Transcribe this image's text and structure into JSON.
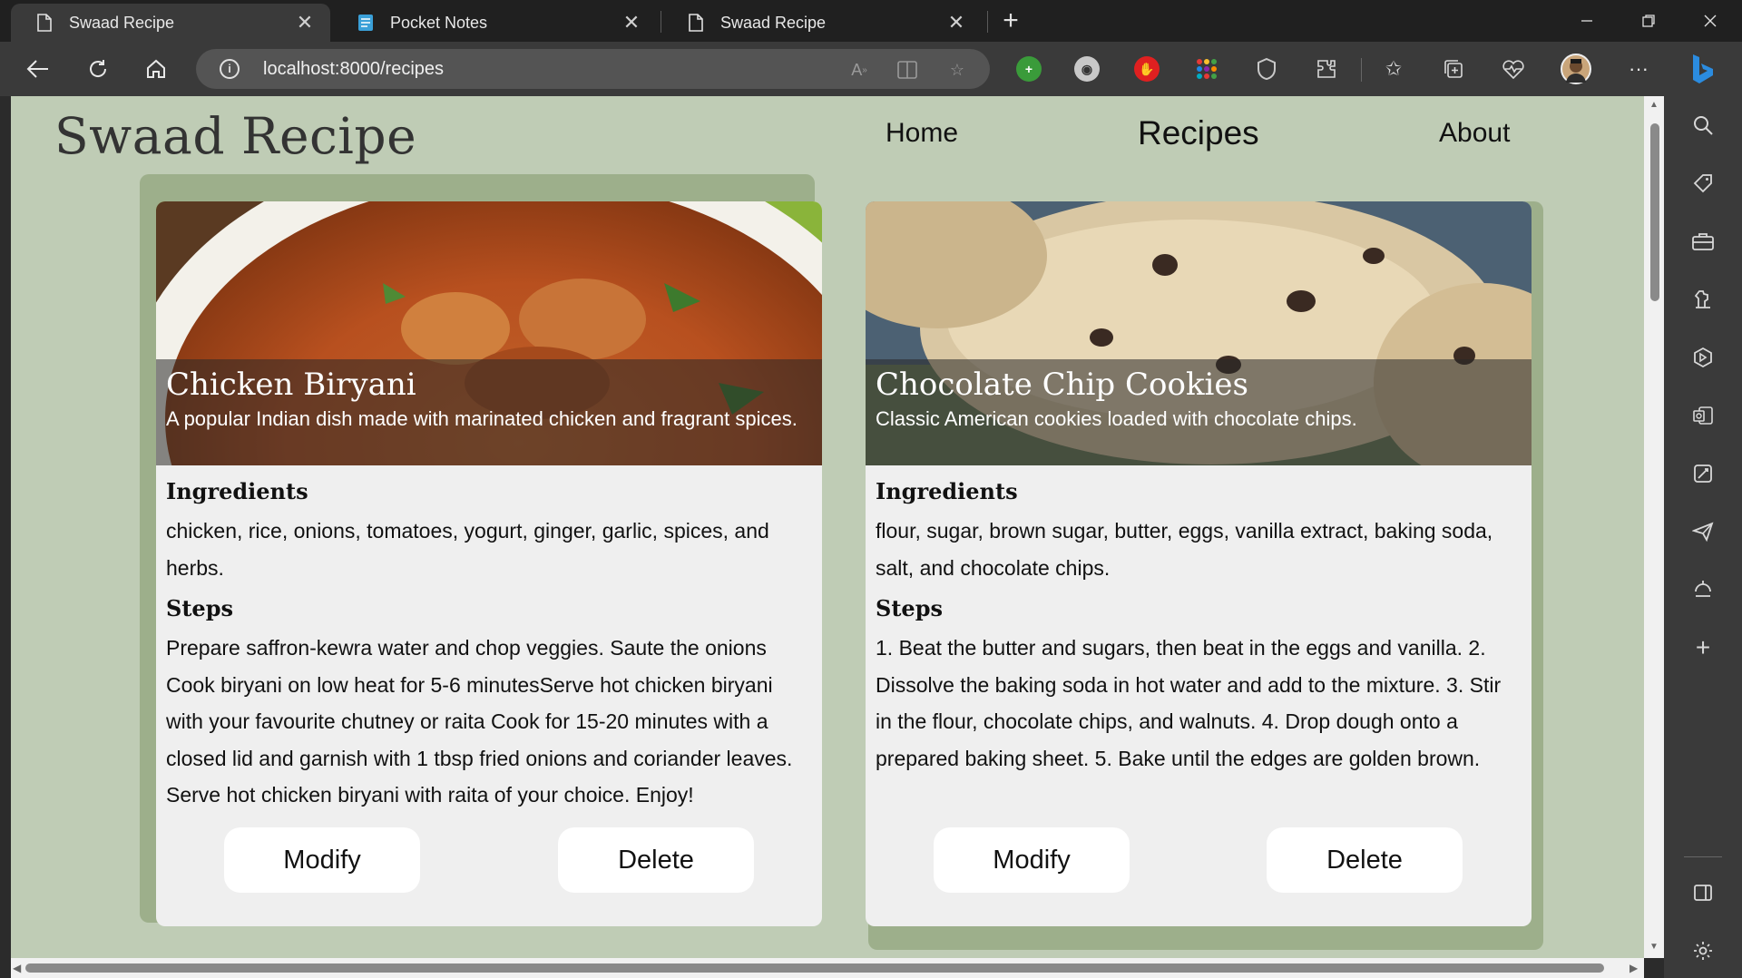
{
  "browser": {
    "tabs": [
      {
        "title": "Swaad Recipe",
        "active": true,
        "icon": "page-icon"
      },
      {
        "title": "Pocket Notes",
        "active": false,
        "icon": "notes-icon"
      },
      {
        "title": "Swaad Recipe",
        "active": false,
        "icon": "page-icon"
      }
    ],
    "address": {
      "url": "localhost:8000/recipes"
    },
    "profile_initial": ""
  },
  "site": {
    "title": "Swaad Recipe",
    "nav": [
      {
        "label": "Home",
        "active": false
      },
      {
        "label": "Recipes",
        "active": true
      },
      {
        "label": "About",
        "active": false
      }
    ]
  },
  "recipes": [
    {
      "name": "Chicken Biryani",
      "description": "A popular Indian dish made with marinated chicken and fragrant spices.",
      "ingredients_heading": "Ingredients",
      "ingredients": "chicken, rice, onions, tomatoes, yogurt, ginger, garlic, spices, and herbs.",
      "steps_heading": "Steps",
      "steps": "Prepare saffron-kewra water and chop veggies. Saute the onions Cook biryani on low heat for 5-6 minutesServe hot chicken biryani with your favourite chutney or raita Cook for 15-20 minutes with a closed lid and garnish with 1 tbsp fried onions and coriander leaves. Serve hot chicken biryani with raita of your choice. Enjoy!",
      "modify_label": "Modify",
      "delete_label": "Delete"
    },
    {
      "name": "Chocolate Chip Cookies",
      "description": "Classic American cookies loaded with chocolate chips.",
      "ingredients_heading": "Ingredients",
      "ingredients": "flour, sugar, brown sugar, butter, eggs, vanilla extract, baking soda, salt, and chocolate chips.",
      "steps_heading": "Steps",
      "steps": "1. Beat the butter and sugars, then beat in the eggs and vanilla. 2. Dissolve the baking soda in hot water and add to the mixture. 3. Stir in the flour, chocolate chips, and walnuts. 4. Drop dough onto a prepared baking sheet. 5. Bake until the edges are golden brown.",
      "modify_label": "Modify",
      "delete_label": "Delete"
    }
  ],
  "colors": {
    "page_background": "#bfccb5",
    "card_background": "#efefef",
    "card_shadow": "#9daf8b",
    "browser_chrome": "#3a3a3a"
  }
}
